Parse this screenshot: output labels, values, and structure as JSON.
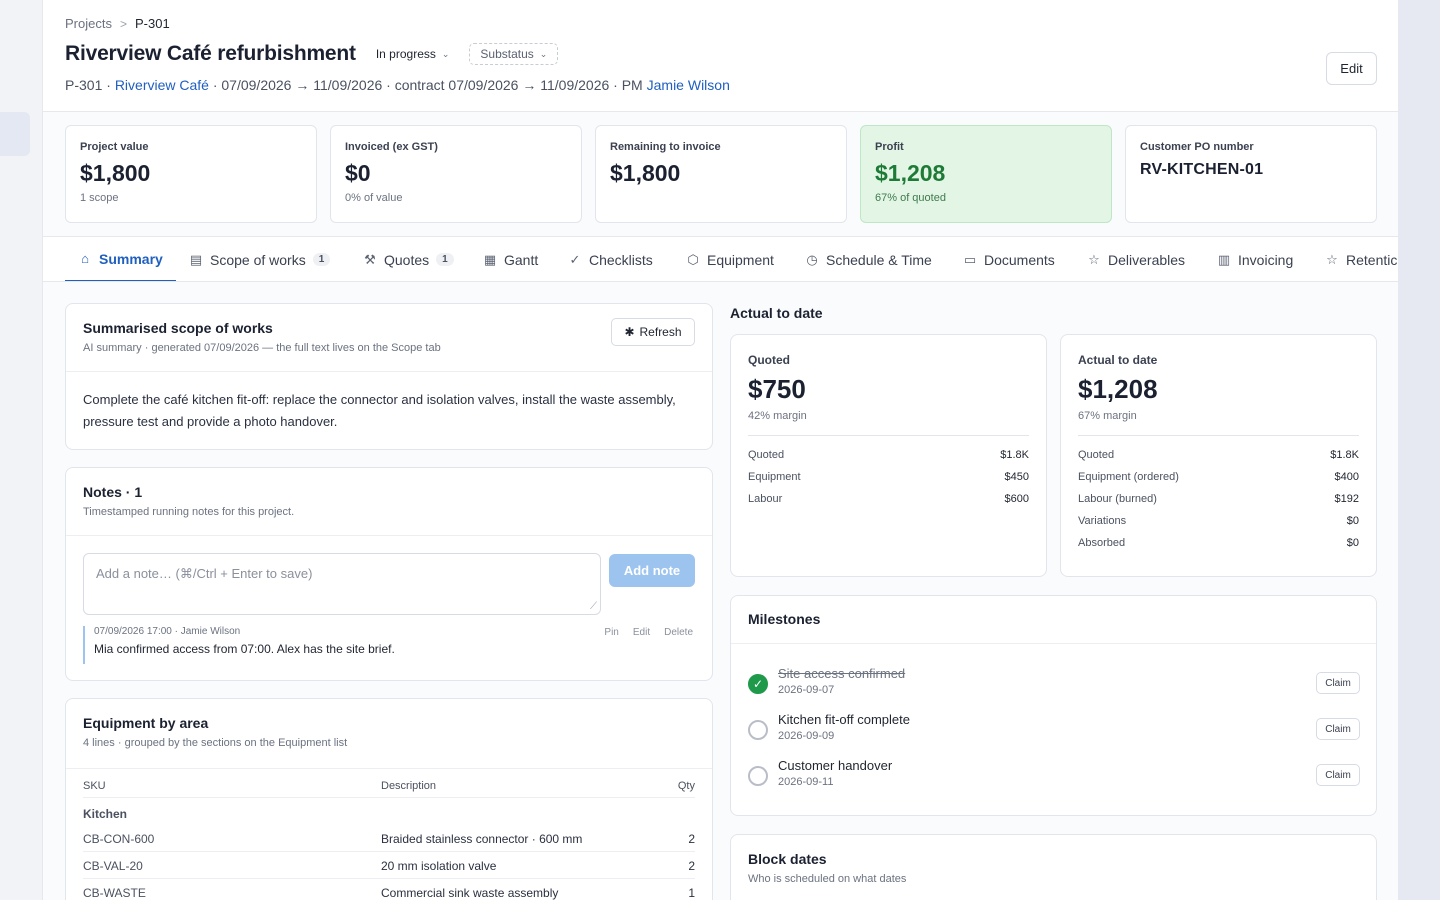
{
  "breadcrumb": {
    "root": "Projects",
    "separator": ">",
    "current": "P-301"
  },
  "header": {
    "title": "Riverview Café refurbishment",
    "status": "In progress",
    "substatus": "Substatus",
    "meta_prefix": "P-301 · ",
    "meta_customer": "Riverview Café",
    "meta_dates": " · 07/09/2026 → 11/09/2026 · contract 07/09/2026 → 11/09/2026 · PM ",
    "meta_pm": "Jamie Wilson",
    "edit_label": "Edit"
  },
  "kpis": [
    {
      "label": "Project value",
      "value": "$1,800",
      "sub": "1 scope"
    },
    {
      "label": "Invoiced (ex GST)",
      "value": "$0",
      "sub": "0% of value"
    },
    {
      "label": "Remaining to invoice",
      "value": "$1,800",
      "sub": ""
    },
    {
      "label": "Profit",
      "value": "$1,208",
      "sub": "67% of quoted"
    },
    {
      "label": "Customer PO number",
      "value": "RV-KITCHEN-01"
    }
  ],
  "tabs": [
    {
      "label": "Summary",
      "icon": "home-icon",
      "glyph": "⌂"
    },
    {
      "label": "Scope of works",
      "count": "1",
      "icon": "document-icon",
      "glyph": "▤"
    },
    {
      "label": "Quotes",
      "count": "1",
      "icon": "hammer-icon",
      "glyph": "⚒"
    },
    {
      "label": "Gantt",
      "icon": "calendar-icon",
      "glyph": "▦"
    },
    {
      "label": "Checklists",
      "icon": "check-icon",
      "glyph": "✓"
    },
    {
      "label": "Equipment",
      "icon": "box-icon",
      "glyph": "⬡"
    },
    {
      "label": "Schedule & Time",
      "icon": "clock-icon",
      "glyph": "◷"
    },
    {
      "label": "Documents",
      "icon": "folder-icon",
      "glyph": "▭"
    },
    {
      "label": "Deliverables",
      "icon": "star-icon",
      "glyph": "☆"
    },
    {
      "label": "Invoicing",
      "icon": "receipt-icon",
      "glyph": "▥"
    },
    {
      "label": "Retentic",
      "icon": "star-icon",
      "glyph": "☆"
    }
  ],
  "scope": {
    "title": "Summarised scope of works",
    "sub": "AI summary · generated 07/09/2026 — the full text lives on the Scope tab",
    "refresh_label": "Refresh",
    "body": "Complete the café kitchen fit-off: replace the connector and isolation valves, install the waste assembly, pressure test and provide a photo handover."
  },
  "notes": {
    "title": "Notes · 1",
    "sub": "Timestamped running notes for this project.",
    "placeholder": "Add a note… (⌘/Ctrl + Enter to save)",
    "add_label": "Add note",
    "items": [
      {
        "meta": "07/09/2026 17:00 · Jamie Wilson",
        "text": "Mia confirmed access from 07:00. Alex has the site brief.",
        "pin": "Pin",
        "edit": "Edit",
        "delete": "Delete"
      }
    ]
  },
  "equipment": {
    "title": "Equipment by area",
    "sub": "4 lines · grouped by the sections on the Equipment list",
    "headers": {
      "sku": "SKU",
      "description": "Description",
      "qty": "Qty"
    },
    "group": "Kitchen",
    "rows": [
      {
        "sku": "CB-CON-600",
        "description": "Braided stainless connector · 600 mm",
        "qty": "2"
      },
      {
        "sku": "CB-VAL-20",
        "description": "20 mm isolation valve",
        "qty": "2"
      },
      {
        "sku": "CB-WASTE",
        "description": "Commercial sink waste assembly",
        "qty": "1"
      }
    ]
  },
  "actual": {
    "heading": "Actual to date",
    "quoted_card": {
      "label": "Quoted",
      "value": "$750",
      "sub": "42% margin",
      "rows": [
        {
          "k": "Quoted",
          "v": "$1.8K"
        },
        {
          "k": "Equipment",
          "v": "$450"
        },
        {
          "k": "Labour",
          "v": "$600"
        }
      ]
    },
    "actual_card": {
      "label": "Actual to date",
      "value": "$1,208",
      "sub": "67% margin",
      "rows": [
        {
          "k": "Quoted",
          "v": "$1.8K"
        },
        {
          "k": "Equipment (ordered)",
          "v": "$400"
        },
        {
          "k": "Labour (burned)",
          "v": "$192"
        },
        {
          "k": "Variations",
          "v": "$0"
        },
        {
          "k": "Absorbed",
          "v": "$0"
        }
      ]
    }
  },
  "milestones": {
    "title": "Milestones",
    "claim_label": "Claim",
    "items": [
      {
        "title": "Site access confirmed",
        "date": "2026-09-07",
        "done": true
      },
      {
        "title": "Kitchen fit-off complete",
        "date": "2026-09-09",
        "done": false
      },
      {
        "title": "Customer handover",
        "date": "2026-09-11",
        "done": false
      }
    ]
  },
  "block_dates": {
    "title": "Block dates",
    "sub": "Who is scheduled on what dates"
  },
  "colors": {
    "accent": "#1f5fbf",
    "profit_bg": "#e3f6e6",
    "profit_text": "#1e7a37",
    "success": "#1e9a4a"
  }
}
